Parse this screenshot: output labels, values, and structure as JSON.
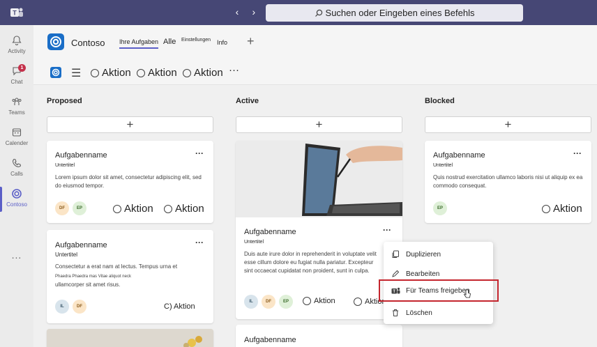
{
  "search": {
    "placeholder": "Suchen oder Eingeben eines Befehls"
  },
  "rail": {
    "items": [
      {
        "label": "Activity",
        "icon": "bell-icon"
      },
      {
        "label": "Chat",
        "icon": "chat-icon",
        "badge": "1"
      },
      {
        "label": "Teams",
        "icon": "teams-icon"
      },
      {
        "label": "Calender",
        "icon": "calendar-icon"
      },
      {
        "label": "Calls",
        "icon": "phone-icon"
      },
      {
        "label": "Contoso",
        "icon": "contoso-icon",
        "active": true
      }
    ],
    "more": "..."
  },
  "header": {
    "app_name": "Contoso",
    "tabs": [
      {
        "label": "Ihre Aufgaben",
        "active": true
      },
      {
        "label": "Alle"
      },
      {
        "label": "Einstellungen"
      },
      {
        "label": "Info"
      }
    ],
    "add_tab": "+"
  },
  "toolbar": {
    "actions": [
      "Aktion",
      "Aktion",
      "Aktion"
    ],
    "more": "···"
  },
  "columns": [
    {
      "title": "Proposed"
    },
    {
      "title": "Active"
    },
    {
      "title": "Blocked"
    }
  ],
  "add_label": "+",
  "cards": {
    "p1": {
      "title": "Aufgabenname",
      "subtitle": "Untertitel",
      "desc": "Lorem ipsum dolor sit amet, consectetur adipiscing elit, sed do eiusmod tempor.",
      "avatars": [
        "DF",
        "EP"
      ],
      "actions": [
        "Aktion",
        "Aktion"
      ],
      "more": "···"
    },
    "p2": {
      "title": "Aufgabenname",
      "subtitle": "Untertitel",
      "desc1": "Consectetur a erat nam at lectus. Tempus urna et",
      "desc2": "Phaedra Phaedra mas Vitae aliquot neck",
      "desc3": "ullamcorper sit amet risus.",
      "avatars": [
        "IL",
        "DF"
      ],
      "action": "C) Aktion",
      "more": "···"
    },
    "a1": {
      "title": "Aufgabenname",
      "subtitle": "Untertitel",
      "desc": "Duis aute irure dolor in reprehenderit in voluptate velit esse cillum dolore eu fugiat nulla pariatur. Excepteur sint occaecat cupidatat non proident, sunt in culpa.",
      "avatars": [
        "IL",
        "DF",
        "EP"
      ],
      "actions": [
        "Aktion",
        "Aktion"
      ],
      "more": "···"
    },
    "a2": {
      "title": "Aufgabenname"
    },
    "b1": {
      "title": "Aufgabenname",
      "subtitle": "Untertitel",
      "desc": "Quis nostrud exercitation ullamco laboris nisi ut aliquip ex ea commodo consequat.",
      "avatars": [
        "EP"
      ],
      "action": "Aktion",
      "more": "···"
    }
  },
  "context_menu": {
    "items": [
      {
        "label": "Duplizieren",
        "icon": "copy-icon"
      },
      {
        "label": "Bearbeiten",
        "icon": "edit-icon"
      },
      {
        "label": "Für Teams freigeben",
        "icon": "teams-share-icon",
        "highlighted": true
      },
      {
        "label": "Löschen",
        "icon": "trash-icon"
      }
    ]
  },
  "colors": {
    "titlebar": "#464775",
    "accent": "#5b5fc7",
    "highlight": "#c4262e",
    "app_blue": "#1a6ec7"
  }
}
